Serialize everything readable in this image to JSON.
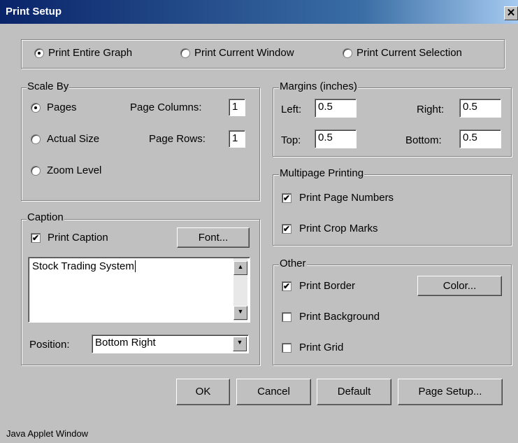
{
  "window": {
    "title": "Print Setup",
    "status": "Java Applet Window"
  },
  "print_range": {
    "options": [
      "Print Entire Graph",
      "Print Current Window",
      "Print Current Selection"
    ],
    "selected": "Print Entire Graph"
  },
  "scale_by": {
    "legend": "Scale By",
    "pages_label": "Pages",
    "actual_size_label": "Actual Size",
    "zoom_level_label": "Zoom Level",
    "selected": "Pages",
    "page_columns_label": "Page Columns:",
    "page_columns_value": "1",
    "page_rows_label": "Page Rows:",
    "page_rows_value": "1"
  },
  "margins": {
    "legend": "Margins (inches)",
    "left_label": "Left:",
    "left_value": "0.5",
    "right_label": "Right:",
    "right_value": "0.5",
    "top_label": "Top:",
    "top_value": "0.5",
    "bottom_label": "Bottom:",
    "bottom_value": "0.5"
  },
  "multipage": {
    "legend": "Multipage Printing",
    "page_numbers_label": "Print Page Numbers",
    "page_numbers_checked": true,
    "crop_marks_label": "Print Crop Marks",
    "crop_marks_checked": true
  },
  "caption": {
    "legend": "Caption",
    "print_caption_label": "Print Caption",
    "print_caption_checked": true,
    "font_button": "Font...",
    "text": "Stock Trading System",
    "position_label": "Position:",
    "position_value": "Bottom Right"
  },
  "other": {
    "legend": "Other",
    "border_label": "Print Border",
    "border_checked": true,
    "color_button": "Color...",
    "background_label": "Print Background",
    "background_checked": false,
    "grid_label": "Print Grid",
    "grid_checked": false
  },
  "buttons": {
    "ok": "OK",
    "cancel": "Cancel",
    "default": "Default",
    "page_setup": "Page Setup..."
  },
  "glyphs": {
    "check": "✔",
    "up": "▲",
    "down": "▼",
    "close": "✕"
  }
}
